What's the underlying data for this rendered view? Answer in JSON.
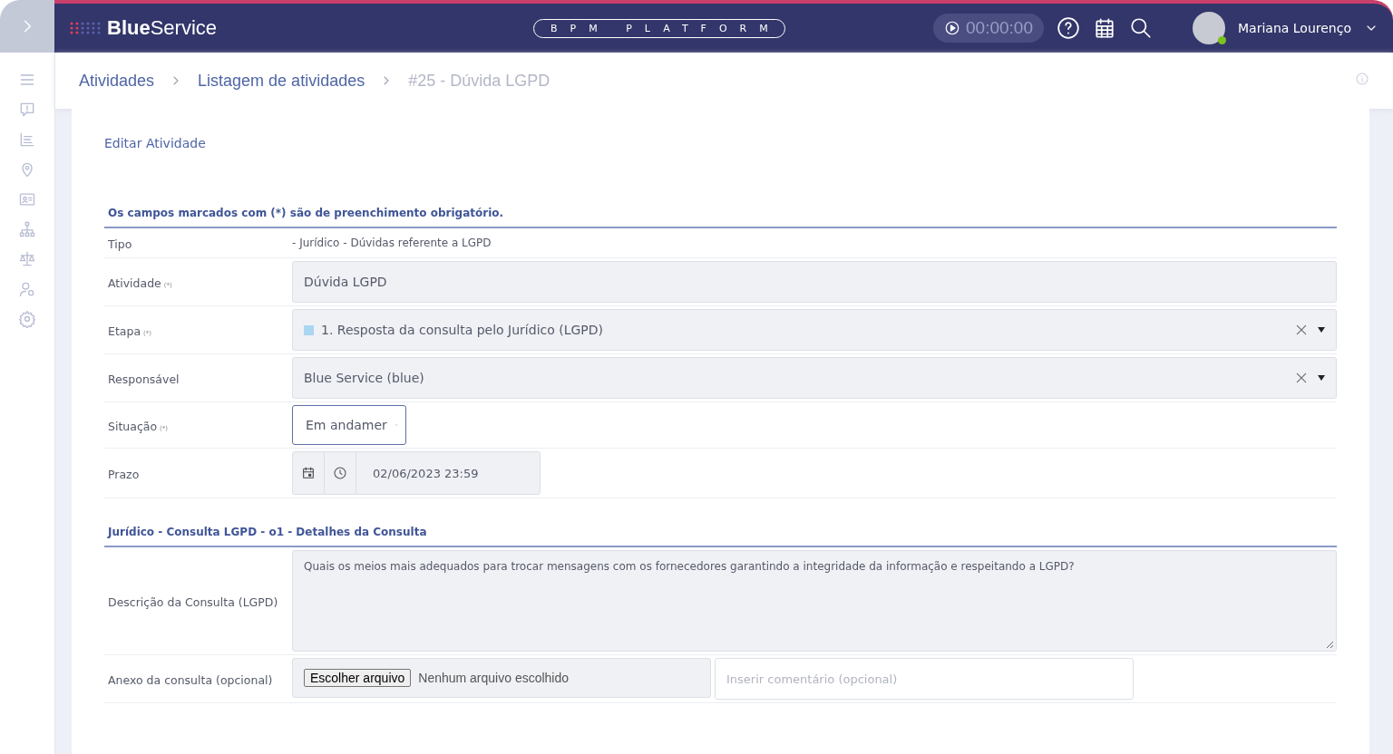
{
  "header": {
    "logo_bold": "Blue",
    "logo_light": "Service",
    "platform": "BPM PLATFORM",
    "timer": "00:00:00",
    "user": "Mariana Lourenço",
    "online": true
  },
  "breadcrumbs": [
    {
      "label": "Atividades",
      "current": false
    },
    {
      "label": "Listagem de atividades",
      "current": false
    },
    {
      "label": "#25 - Dúvida LGPD",
      "current": true
    }
  ],
  "form_title": "Editar Atividade",
  "sections": [
    {
      "title": "Os campos marcados com (*) são de preenchimento obrigatório.",
      "fields": [
        {
          "kind": "static",
          "label": "Tipo",
          "value": "- Jurídico - Dúvidas referente a LGPD"
        },
        {
          "kind": "input",
          "label": "Atividade",
          "required_mark": "(*)",
          "value": "Dúvida LGPD"
        },
        {
          "kind": "select-clear",
          "label": "Etapa",
          "required_mark": "(*)",
          "value": "1. Resposta da consulta pelo Jurídico (LGPD)",
          "color": "#a9d6f0"
        },
        {
          "kind": "select-clear",
          "label": "Responsável",
          "value": "Blue Service (blue)"
        },
        {
          "kind": "select",
          "label": "Situação",
          "required_mark": "(*)",
          "value": "Em andamer"
        },
        {
          "kind": "datetime",
          "label": "Prazo",
          "value": "02/06/2023 23:59"
        }
      ]
    },
    {
      "title": "Jurídico - Consulta LGPD - o1 - Detalhes da Consulta",
      "fields": [
        {
          "kind": "textarea",
          "label": "Descrição da Consulta (LGPD)",
          "value": "Quais os meios mais adequados para trocar mensagens com os fornecedores garantindo a integridade da informação e respeitando a LGPD?"
        },
        {
          "kind": "file",
          "label": "Anexo da consulta (opcional)",
          "button": "Escolher arquivo",
          "file_status": "Nenhum arquivo escolhido",
          "placeholder": "Inserir comentário (opcional)"
        }
      ]
    }
  ]
}
